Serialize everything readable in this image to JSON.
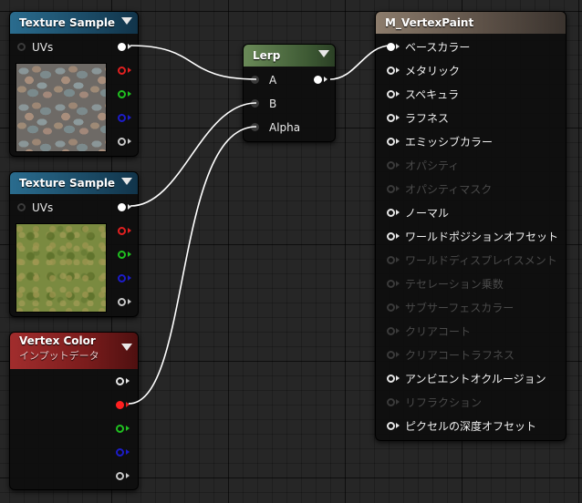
{
  "nodes": {
    "texture_sample_1": {
      "title": "Texture Sample",
      "input_label": "UVs"
    },
    "texture_sample_2": {
      "title": "Texture Sample",
      "input_label": "UVs"
    },
    "vertex_color": {
      "title": "Vertex Color",
      "subtitle": "インプットデータ"
    },
    "lerp": {
      "title": "Lerp",
      "inputs": [
        "A",
        "B",
        "Alpha"
      ]
    },
    "material": {
      "title": "M_VertexPaint",
      "inputs": [
        {
          "label": "ベースカラー",
          "enabled": true
        },
        {
          "label": "メタリック",
          "enabled": true
        },
        {
          "label": "スペキュラ",
          "enabled": true
        },
        {
          "label": "ラフネス",
          "enabled": true
        },
        {
          "label": "エミッシブカラー",
          "enabled": true
        },
        {
          "label": "オパシティ",
          "enabled": false
        },
        {
          "label": "オパシティマスク",
          "enabled": false
        },
        {
          "label": "ノーマル",
          "enabled": true
        },
        {
          "label": "ワールドポジションオフセット",
          "enabled": true
        },
        {
          "label": "ワールドディスプレイスメント",
          "enabled": false
        },
        {
          "label": "テセレーション乗数",
          "enabled": false
        },
        {
          "label": "サブサーフェスカラー",
          "enabled": false
        },
        {
          "label": "クリアコート",
          "enabled": false
        },
        {
          "label": "クリアコートラフネス",
          "enabled": false
        },
        {
          "label": "アンビエントオクルージョン",
          "enabled": true
        },
        {
          "label": "リフラクション",
          "enabled": false
        },
        {
          "label": "ピクセルの深度オフセット",
          "enabled": true
        }
      ]
    }
  },
  "colors": {
    "texture_header": "#2a6c8e",
    "lerp_header": "#6a8a58",
    "vertex_color_header": "#a12d2d",
    "material_header": "#8c7c6c",
    "wire": "#ffffff"
  }
}
